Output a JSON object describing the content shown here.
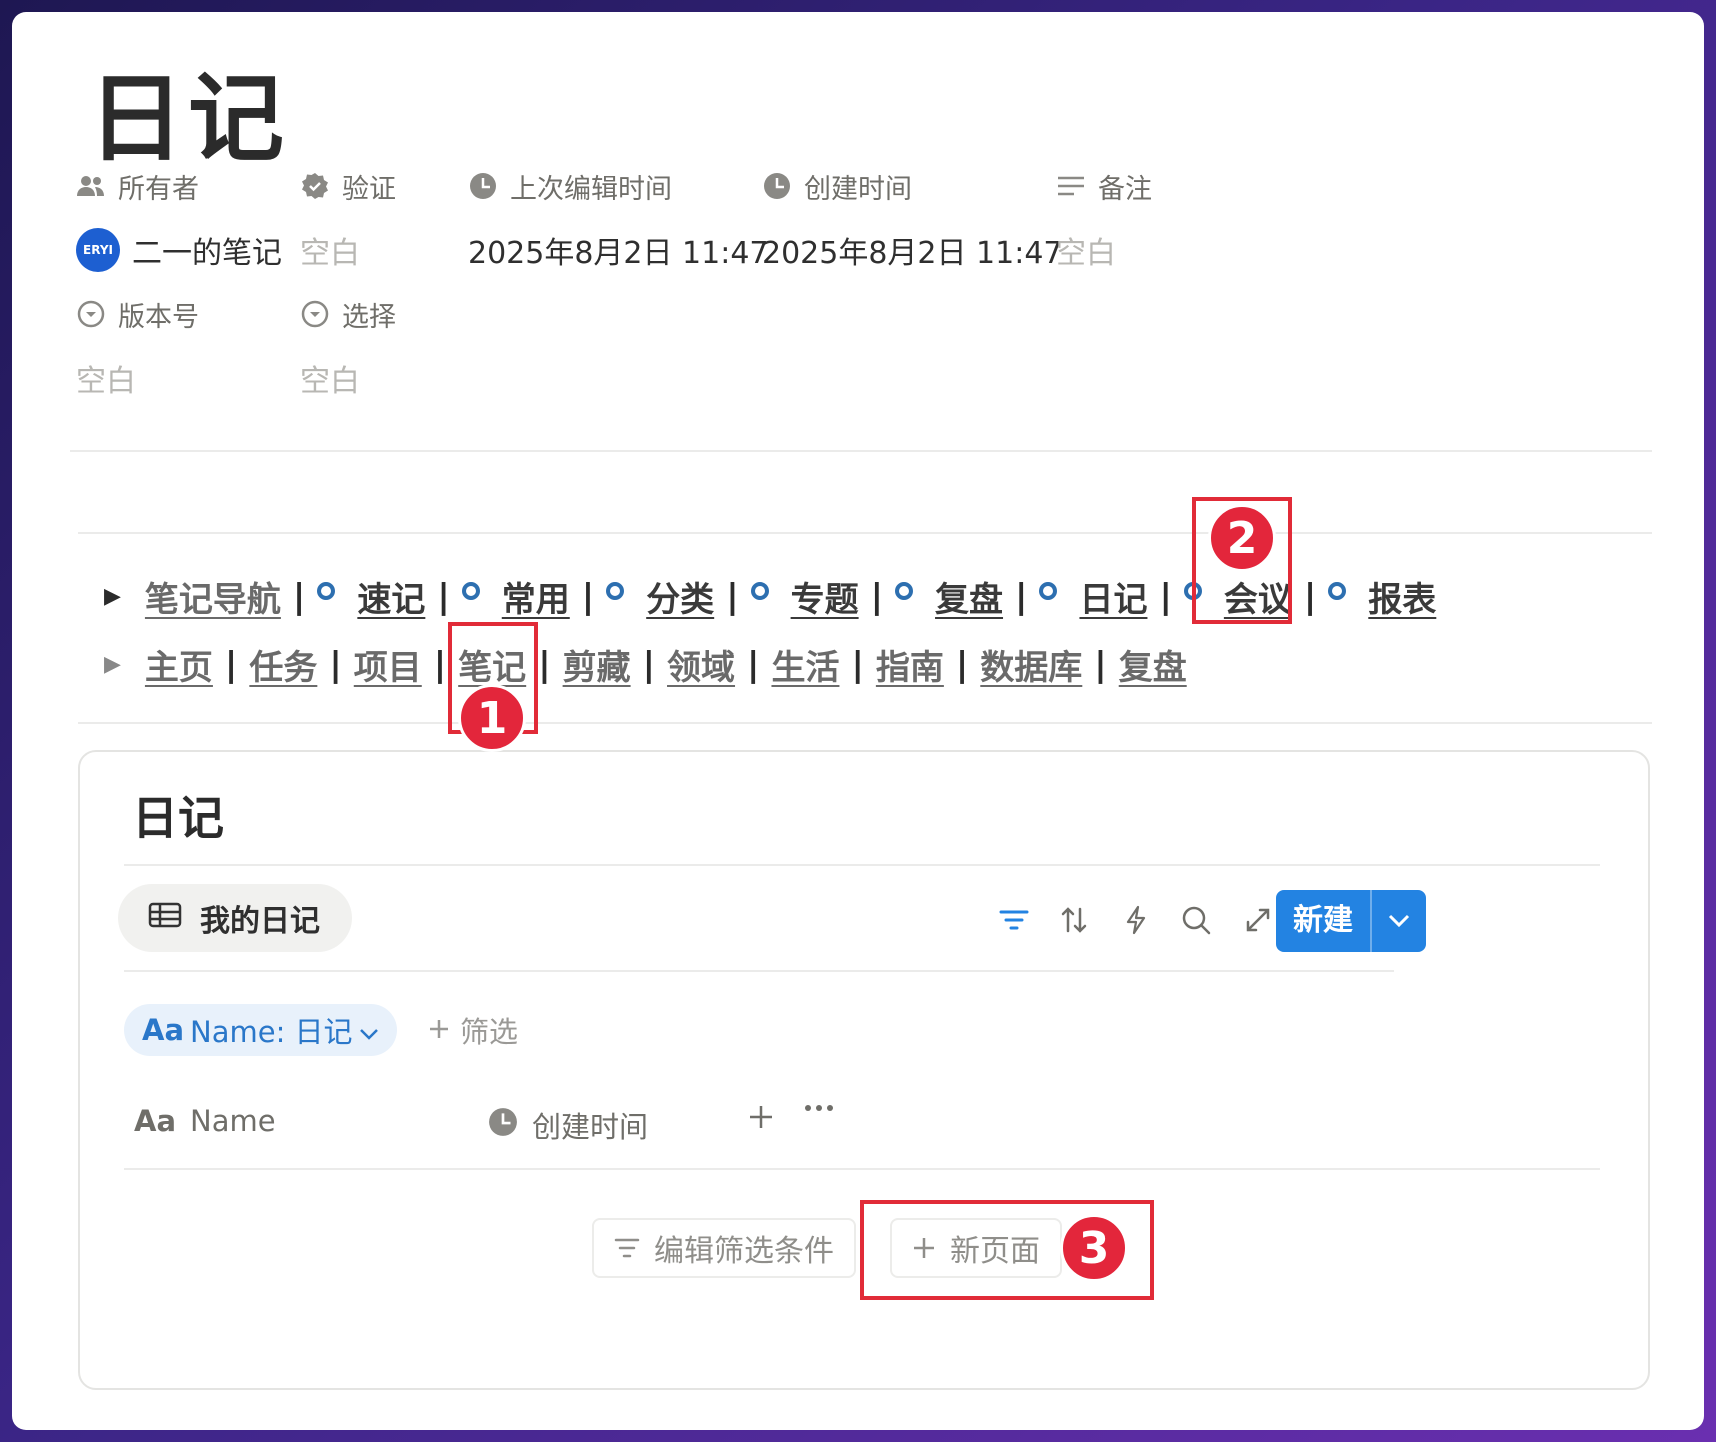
{
  "page": {
    "title": "日记"
  },
  "properties": {
    "owner": {
      "label": "所有者",
      "avatar": "ERYI",
      "value": "二一的笔记"
    },
    "verify": {
      "label": "验证",
      "value": "空白"
    },
    "last_edited": {
      "label": "上次编辑时间",
      "value": "2025年8月2日 11:47"
    },
    "created": {
      "label": "创建时间",
      "value": "2025年8月2日 11:47"
    },
    "notes": {
      "label": "备注",
      "value": "空白"
    },
    "version": {
      "label": "版本号",
      "value": "空白"
    },
    "select": {
      "label": "选择",
      "value": "空白"
    }
  },
  "nav": {
    "row1": [
      "笔记导航",
      "速记",
      "常用",
      "分类",
      "专题",
      "复盘",
      "日记",
      "会议",
      "报表"
    ],
    "row2": [
      "主页",
      "任务",
      "项目",
      "笔记",
      "剪藏",
      "领域",
      "生活",
      "指南",
      "数据库",
      "复盘"
    ],
    "separator": "|"
  },
  "database": {
    "title": "日记",
    "view_tab": "我的日记",
    "new_button": "新建",
    "filter_chip": {
      "prefix": "Aa",
      "label": "Name: 日记"
    },
    "add_filter": "筛选",
    "columns": [
      {
        "prefix": "Aa",
        "label": "Name"
      },
      {
        "label": "创建时间"
      }
    ],
    "edit_filter_button": "编辑筛选条件",
    "new_page_button": "新页面"
  },
  "annotations": [
    "1",
    "2",
    "3"
  ],
  "colors": {
    "accent": "#2383e2",
    "annotation": "#e3263b",
    "nav_dot": "#2d6fb0"
  }
}
